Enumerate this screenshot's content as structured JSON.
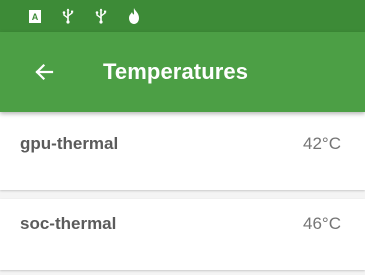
{
  "status_bar": {
    "icons": [
      "text-a-icon",
      "usb-icon",
      "usb-icon",
      "fire-icon"
    ]
  },
  "app_bar": {
    "title": "Temperatures",
    "back_icon": "arrow-left-icon"
  },
  "sensors": [
    {
      "name": "gpu-thermal",
      "value": "42°C"
    },
    {
      "name": "soc-thermal",
      "value": "46°C"
    }
  ],
  "colors": {
    "status_bar": "#3d8b37",
    "app_bar": "#4c9f45",
    "background": "#f4f4f4",
    "card": "#ffffff"
  }
}
